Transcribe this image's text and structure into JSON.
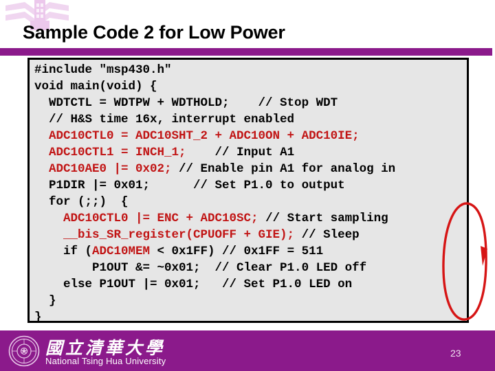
{
  "slide": {
    "title": "Sample Code 2 for Low Power",
    "page_number": "23",
    "accent_color": "#8b1a8b",
    "code_keyword_color": "#c11414",
    "annotation_color": "#d61515",
    "code_background": "#e6e6e6"
  },
  "watermark": {
    "icon": "chevron-tower-logo",
    "color": "#f0d8f0"
  },
  "code": {
    "language": "c",
    "lines": [
      [
        {
          "t": "#include \"msp430.h\"",
          "c": "blk"
        }
      ],
      [
        {
          "t": "void main(void) {",
          "c": "blk"
        }
      ],
      [
        {
          "t": "  WDTCTL = WDTPW + WDTHOLD;    // Stop WDT",
          "c": "blk"
        }
      ],
      [
        {
          "t": "  // H&S time 16x, interrupt enabled",
          "c": "blk"
        }
      ],
      [
        {
          "t": "  ADC10CTL0 = ADC10SHT_2 + ADC10ON + ADC10IE;",
          "c": "red"
        }
      ],
      [
        {
          "t": "  ADC10CTL1 = INCH_1;",
          "c": "red"
        },
        {
          "t": "    // Input A1",
          "c": "blk"
        }
      ],
      [
        {
          "t": "  ADC10AE0 |= 0x02;",
          "c": "red"
        },
        {
          "t": " // Enable pin A1 for analog in",
          "c": "blk"
        }
      ],
      [
        {
          "t": "  P1DIR |= 0x01;      // Set P1.0 to output",
          "c": "blk"
        }
      ],
      [
        {
          "t": "  for (;;)  {",
          "c": "blk"
        }
      ],
      [
        {
          "t": "    ADC10CTL0 |= ENC + ADC10SC;",
          "c": "red"
        },
        {
          "t": " // Start sampling",
          "c": "blk"
        }
      ],
      [
        {
          "t": "    __bis_SR_register(CPUOFF + GIE);",
          "c": "red"
        },
        {
          "t": " // Sleep",
          "c": "blk"
        }
      ],
      [
        {
          "t": "    if (",
          "c": "blk"
        },
        {
          "t": "ADC10MEM",
          "c": "red"
        },
        {
          "t": " < 0x1FF) // 0x1FF = 511",
          "c": "blk"
        }
      ],
      [
        {
          "t": "        P1OUT &= ~0x01;  // Clear P1.0 LED off",
          "c": "blk"
        }
      ],
      [
        {
          "t": "    else P1OUT |= 0x01;   // Set P1.0 LED on",
          "c": "blk"
        }
      ],
      [
        {
          "t": "  }",
          "c": "blk"
        }
      ],
      [
        {
          "t": "}",
          "c": "blk"
        }
      ]
    ]
  },
  "annotation": {
    "shape": "ellipse-with-arrowhead",
    "target": "code-block-right-edge"
  },
  "footer": {
    "seal_icon": "university-seal",
    "university_name_cn": "國立清華大學",
    "university_name_en": "National Tsing Hua University"
  }
}
